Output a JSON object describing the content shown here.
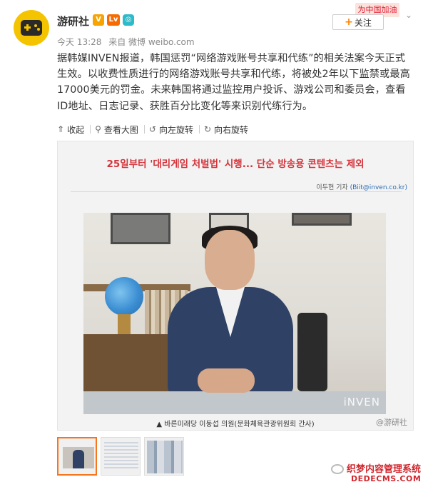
{
  "header": {
    "name": "游研社",
    "badges": [
      "V",
      "Lv",
      "◎"
    ],
    "time": "今天 13:28",
    "source": "来自 微博 weibo.com",
    "follow_label": "关注",
    "follow_plus": "+",
    "promo": "为中国加油",
    "chevron": "⌄"
  },
  "post": {
    "text": "据韩媒INVEN报道，韩国惩罚“网络游戏账号共享和代练”的相关法案今天正式生效。以收费性质进行的网络游戏账号共享和代练，将被处2年以下监禁或最高17000美元的罚金。未来韩国将通过监控用户投诉、游戏公司和委员会，查看ID地址、日志记录、获胜百分比变化等来识别代练行为。"
  },
  "toolbar": {
    "collapse": "收起",
    "view_large": "查看大图",
    "rotate_left": "向左旋转",
    "rotate_right": "向右旋转"
  },
  "article": {
    "headline": "25일부터 '대리게임 처벌법' 시행... 단순 방송용 콘텐츠는 제외",
    "byline": "이두현 기자",
    "email": "(Biit@inven.co.kr)",
    "photo_watermark": "iNVEN",
    "caption_bullet": "▲",
    "caption": "바른미래당 이동섭 의원(문화체육관광위원회 간사)",
    "weibo_watermark": "@游研社"
  },
  "site_watermark": {
    "line1": "织梦内容管理系统",
    "line2": "DEDECMS.COM"
  },
  "icons": {
    "collapse": "up-arrow-icon",
    "view": "search-icon",
    "rotate_left": "rotate-left-icon",
    "rotate_right": "rotate-right-icon"
  }
}
